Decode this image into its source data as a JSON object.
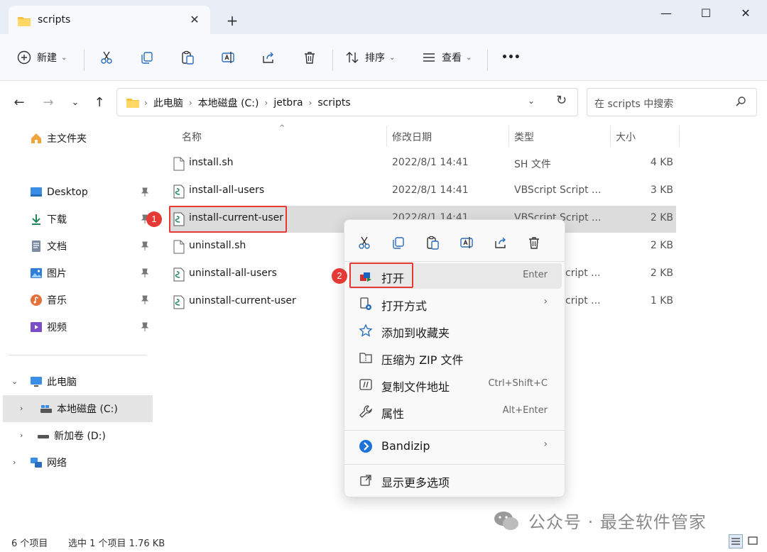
{
  "window": {
    "tab_title": "scripts",
    "close_tab": "✕",
    "new_tab": "+",
    "minimize": "—",
    "maximize": "☐",
    "close": "✕"
  },
  "toolbar": {
    "new_label": "新建",
    "sort_label": "排序",
    "view_label": "查看",
    "more_label": "•••"
  },
  "address": {
    "crumbs": [
      "此电脑",
      "本地磁盘 (C:)",
      "jetbra",
      "scripts"
    ],
    "search_placeholder": "在 scripts 中搜索"
  },
  "sidebar": {
    "home": "主文件夹",
    "quick": [
      "Desktop",
      "下载",
      "文档",
      "图片",
      "音乐",
      "视频"
    ],
    "this_pc": "此电脑",
    "drive_c": "本地磁盘 (C:)",
    "drive_d": "新加卷 (D:)",
    "network": "网络"
  },
  "columns": {
    "name": "名称",
    "date": "修改日期",
    "type": "类型",
    "size": "大小"
  },
  "files": [
    {
      "name": "install.sh",
      "date": "2022/8/1 14:41",
      "type": "SH 文件",
      "size": "4 KB"
    },
    {
      "name": "install-all-users",
      "date": "2022/8/1 14:41",
      "type": "VBScript Script ...",
      "size": "3 KB"
    },
    {
      "name": "install-current-user",
      "date": "2022/8/1 14:41",
      "type": "VBScript Script ...",
      "size": "2 KB"
    },
    {
      "name": "uninstall.sh",
      "date": "",
      "type": "",
      "size": "2 KB"
    },
    {
      "name": "uninstall-all-users",
      "date": "",
      "type": "cript ...",
      "size": "2 KB"
    },
    {
      "name": "uninstall-current-user",
      "date": "",
      "type": "cript ...",
      "size": "1 KB"
    }
  ],
  "context_menu": {
    "open": "打开",
    "open_shortcut": "Enter",
    "open_with": "打开方式",
    "add_favorites": "添加到收藏夹",
    "compress_zip": "压缩为 ZIP 文件",
    "copy_path": "复制文件地址",
    "copy_path_shortcut": "Ctrl+Shift+C",
    "properties": "属性",
    "properties_shortcut": "Alt+Enter",
    "bandizip": "Bandizip",
    "more_options": "显示更多选项",
    "submenu_arrow": "›"
  },
  "annotations": {
    "badge1": "1",
    "badge2": "2"
  },
  "status": {
    "count": "6 个项目",
    "selection": "选中 1 个项目  1.76 KB"
  },
  "watermark": "公众号 · 最全软件管家",
  "colors": {
    "accent": "#0067c0",
    "highlight_red": "#e53935",
    "selected_row": "#dcdcdc"
  }
}
